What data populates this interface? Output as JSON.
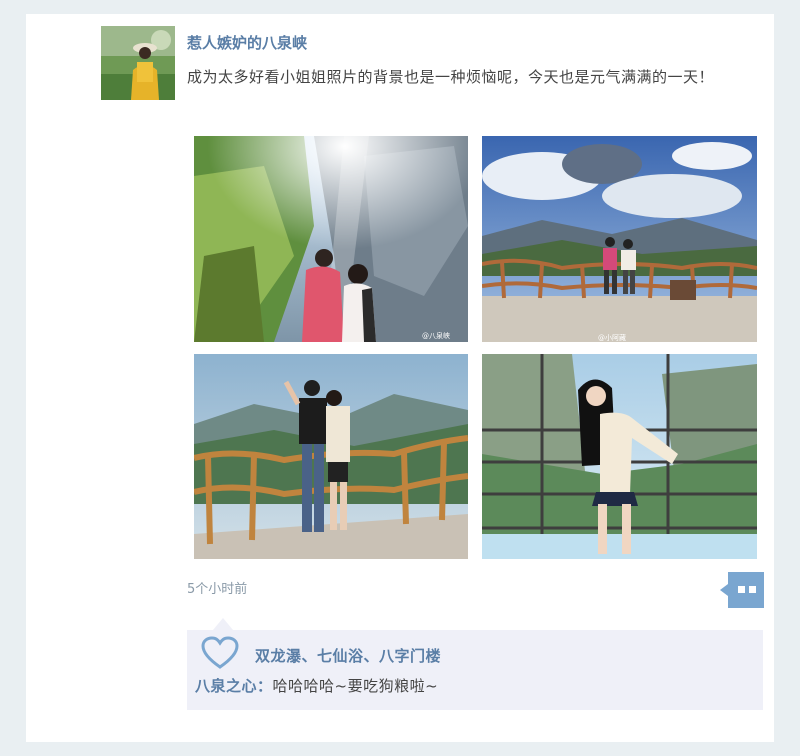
{
  "post": {
    "author": "惹人嫉妒的八泉峡",
    "text": "成为太多好看小姐姐照片的背景也是一种烦恼呢，今天也是元气满满的一天！",
    "timestamp": "5个小时前"
  },
  "photos": [
    {
      "name": "cliff-sunlight-couple-photo",
      "watermark": "@八泉峡"
    },
    {
      "name": "viewing-platform-couple-photo",
      "watermark": "@小阿藏"
    },
    {
      "name": "railing-couple-photo"
    },
    {
      "name": "glass-walkway-girl-photo"
    }
  ],
  "likes": {
    "names": "双龙瀑、七仙浴、八字门楼"
  },
  "comments": [
    {
      "author": "八泉之心：",
      "text": "哈哈哈哈~要吃狗粮啦~"
    }
  ],
  "colors": {
    "accent": "#5a7ea6",
    "background": "#e9eff2",
    "panel": "#eff0f8"
  }
}
